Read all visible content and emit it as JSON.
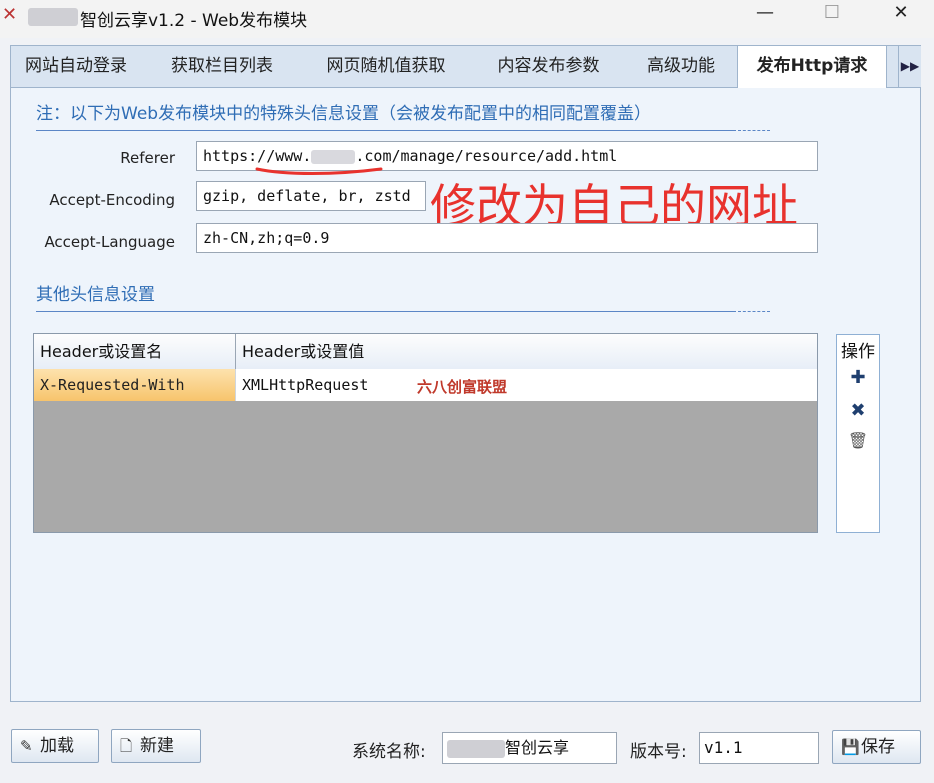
{
  "window": {
    "title": "智创云享v1.2 - Web发布模块",
    "minimize_glyph": "—",
    "maximize_glyph": "☐",
    "close_glyph": "✕"
  },
  "tabs": [
    {
      "label": "网站自动登录",
      "active": false
    },
    {
      "label": "获取栏目列表",
      "active": false
    },
    {
      "label": "网页随机值获取",
      "active": false
    },
    {
      "label": "内容发布参数",
      "active": false
    },
    {
      "label": "高级功能",
      "active": false
    },
    {
      "label": "发布Http请求",
      "active": true
    }
  ],
  "tab_scroll_glyph": "▶▶",
  "note": "注：以下为Web发布模块中的特殊头信息设置（会被发布配置中的相同配置覆盖）",
  "fields": {
    "referer": {
      "label": "Referer",
      "value_prefix": "https://www.",
      "value_suffix": ".com/manage/resource/add.html"
    },
    "accept_encoding": {
      "label": "Accept-Encoding",
      "value": "gzip, deflate, br, zstd"
    },
    "accept_language": {
      "label": "Accept-Language",
      "value": "zh-CN,zh;q=0.9"
    }
  },
  "annotation": "修改为自己的网址",
  "other_headers_title": "其他头信息设置",
  "table": {
    "columns": [
      "Header或设置名",
      "Header或设置值"
    ],
    "rows": [
      {
        "name": "X-Requested-With",
        "value": "XMLHttpRequest"
      }
    ]
  },
  "watermark": "六八创富联盟",
  "ops": {
    "title": "操作",
    "add_glyph": "✚",
    "remove_glyph": "✖",
    "delete_glyph": "🗑"
  },
  "bottom": {
    "load_label": "加载",
    "new_label": "新建",
    "system_name_label": "系统名称:",
    "system_name_value": "智创云享",
    "version_label": "版本号:",
    "version_value": "v1.1",
    "save_label": "保存"
  },
  "colors": {
    "accent_blue": "#2f6db5",
    "annotation_red": "#e8322d",
    "selected_row": "#f7c46c"
  }
}
